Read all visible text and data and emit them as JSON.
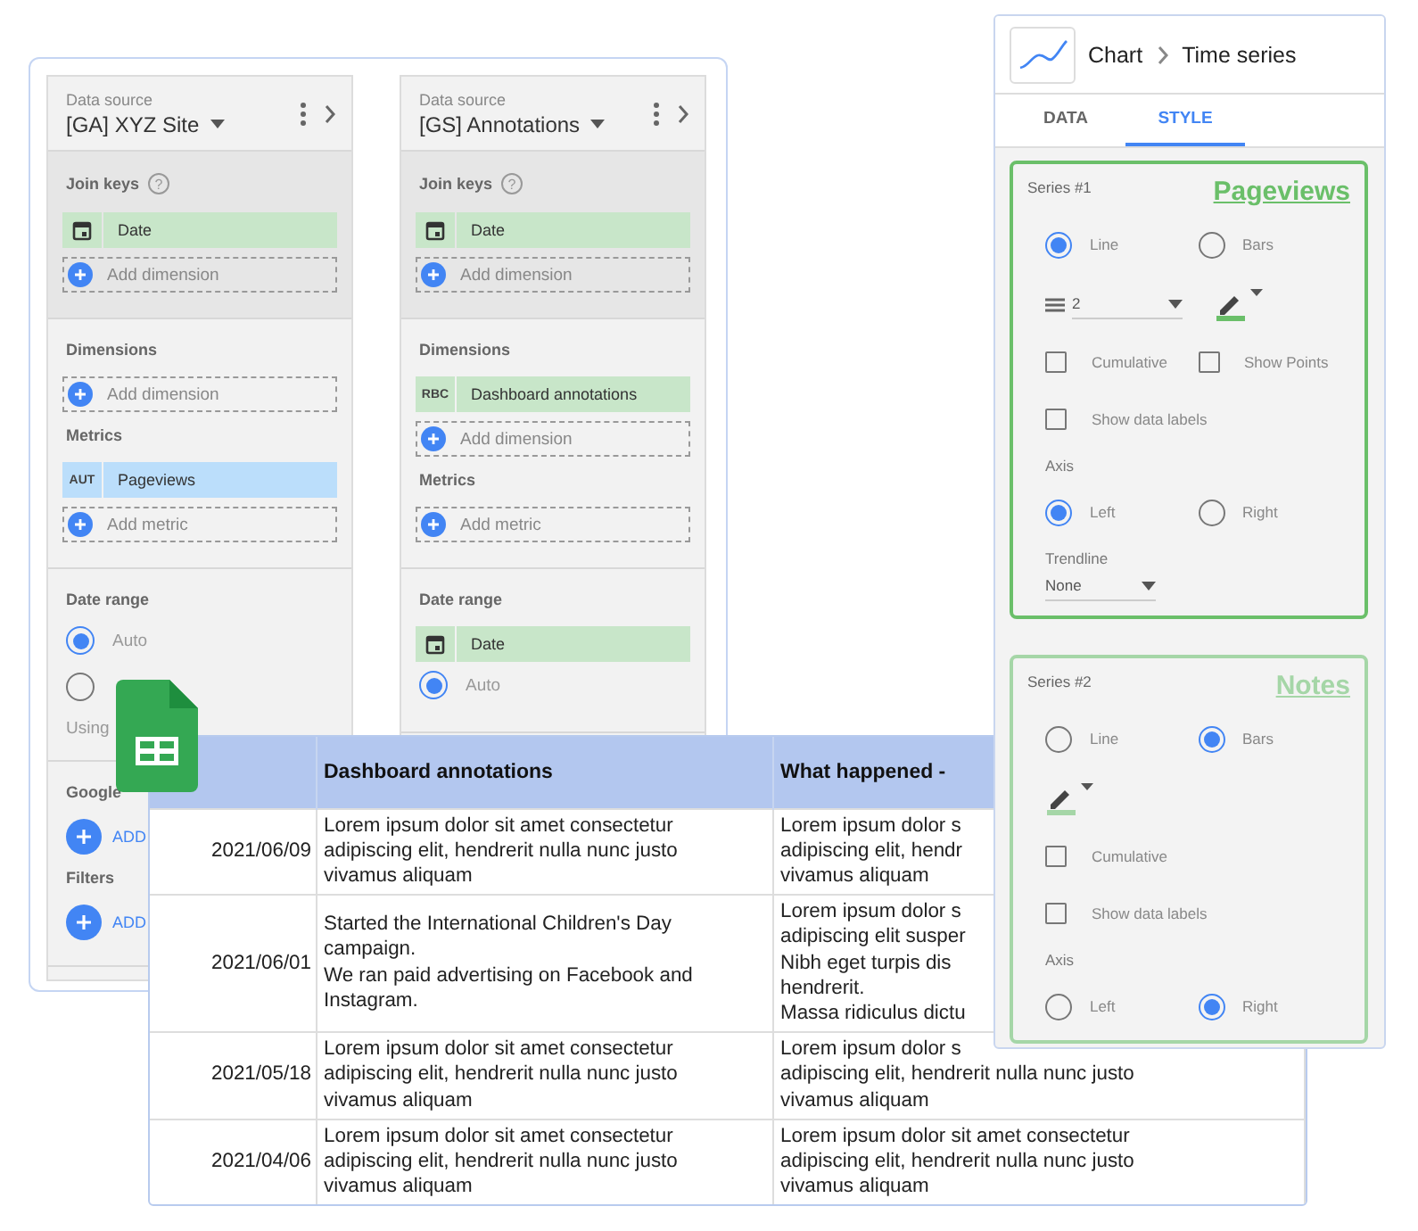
{
  "data_sources": [
    {
      "caption": "Data source",
      "name": "[GA] XYZ Site",
      "groups": [
        {
          "shaded": true,
          "blocks": [
            {
              "title": "Join keys",
              "help": "?",
              "items": [
                {
                  "kind": "date-chip",
                  "label": "Date",
                  "color": "#c8e6c9"
                },
                {
                  "kind": "add",
                  "label": "Add dimension"
                }
              ]
            }
          ]
        },
        {
          "shaded": false,
          "blocks": [
            {
              "title": "Dimensions",
              "items": [
                {
                  "kind": "add",
                  "label": "Add dimension"
                }
              ]
            },
            {
              "title": "Metrics",
              "items": [
                {
                  "kind": "chip",
                  "badge": "AUT",
                  "label": "Pageviews",
                  "color": "#bbdefb"
                },
                {
                  "kind": "add",
                  "label": "Add metric"
                }
              ]
            }
          ]
        },
        {
          "shaded": false,
          "blocks": [
            {
              "title": "Date range",
              "items": [
                {
                  "kind": "radio",
                  "label": "Auto",
                  "selected": true
                },
                {
                  "kind": "radio",
                  "selected": false
                },
                {
                  "kind": "note",
                  "label": "Using"
                }
              ]
            }
          ]
        },
        {
          "shaded": false,
          "blocks": [
            {
              "title": "Google",
              "items": [
                {
                  "kind": "link",
                  "label": "ADD"
                }
              ]
            },
            {
              "title": "Filters",
              "items": [
                {
                  "kind": "link",
                  "label": "ADD"
                }
              ]
            }
          ]
        }
      ]
    },
    {
      "caption": "Data source",
      "name": "[GS] Annotations",
      "groups": [
        {
          "shaded": true,
          "blocks": [
            {
              "title": "Join keys",
              "help": "?",
              "items": [
                {
                  "kind": "date-chip",
                  "label": "Date",
                  "color": "#c8e6c9"
                },
                {
                  "kind": "add",
                  "label": "Add dimension"
                }
              ]
            }
          ]
        },
        {
          "shaded": false,
          "blocks": [
            {
              "title": "Dimensions",
              "items": [
                {
                  "kind": "chip",
                  "badge": "RBC",
                  "label": "Dashboard annotations",
                  "color": "#c8e6c9"
                },
                {
                  "kind": "add",
                  "label": "Add dimension"
                }
              ]
            },
            {
              "title": "Metrics",
              "items": [
                {
                  "kind": "add",
                  "label": "Add metric"
                }
              ]
            }
          ]
        },
        {
          "shaded": false,
          "blocks": [
            {
              "title": "Date range",
              "items": [
                {
                  "kind": "date-chip",
                  "label": "Date",
                  "color": "#c8e6c9"
                },
                {
                  "kind": "radio",
                  "label": "Auto",
                  "selected": true
                }
              ]
            }
          ]
        }
      ]
    }
  ],
  "table": {
    "columns": [
      "Dashboard annotations",
      "What happened -"
    ],
    "rows": [
      {
        "date": "2021/06/09",
        "annotation": "Lorem ipsum dolor sit amet consectetur\nadipiscing elit, hendrerit nulla nunc justo\nvivamus aliquam",
        "detail": "Lorem ipsum dolor s\nadipiscing elit, hendr\nvivamus aliquam"
      },
      {
        "date": "2021/06/01",
        "annotation": "Started the International Children's Day\ncampaign.\nWe ran paid advertising on Facebook and\nInstagram.",
        "detail": "Lorem ipsum dolor s\nadipiscing elit susper\nNibh eget turpis dis\nhendrerit.\nMassa ridiculus dictu"
      },
      {
        "date": "2021/05/18",
        "annotation": "Lorem ipsum dolor sit amet consectetur\nadipiscing elit, hendrerit nulla nunc justo\nvivamus aliquam",
        "detail": "Lorem ipsum dolor s\nadipiscing elit, hendrerit nulla nunc justo\nvivamus aliquam"
      },
      {
        "date": "2021/04/06",
        "annotation": "Lorem ipsum dolor sit amet consectetur\nadipiscing elit, hendrerit nulla nunc justo\nvivamus aliquam",
        "detail": "Lorem ipsum dolor sit amet consectetur\nadipiscing elit, hendrerit nulla nunc justo\nvivamus aliquam"
      }
    ]
  },
  "chart": {
    "breadcrumb": [
      "Chart",
      "Time series"
    ],
    "tabs": [
      {
        "label": "DATA",
        "selected": false
      },
      {
        "label": "STYLE",
        "selected": true
      }
    ],
    "series": [
      {
        "caption": "Series #1",
        "title": "Pageviews",
        "color": "#6abf69",
        "controls": [
          {
            "kind": "radios",
            "options": [
              {
                "label": "Line",
                "selected": true
              },
              {
                "label": "Bars",
                "selected": false
              }
            ]
          },
          {
            "kind": "style",
            "weight": "2"
          },
          {
            "kind": "checks",
            "options": [
              {
                "label": "Cumulative",
                "checked": false
              },
              {
                "label": "Show Points",
                "checked": false
              }
            ]
          },
          {
            "kind": "checks",
            "options": [
              {
                "label": "Show data labels",
                "checked": false
              }
            ]
          },
          {
            "kind": "label",
            "label": "Axis"
          },
          {
            "kind": "radios",
            "options": [
              {
                "label": "Left",
                "selected": true
              },
              {
                "label": "Right",
                "selected": false
              }
            ]
          },
          {
            "kind": "select",
            "label": "Trendline",
            "value": "None"
          }
        ]
      },
      {
        "caption": "Series #2",
        "title": "Notes",
        "color": "#a5d6a7",
        "controls": [
          {
            "kind": "radios",
            "options": [
              {
                "label": "Line",
                "selected": false
              },
              {
                "label": "Bars",
                "selected": true
              }
            ]
          },
          {
            "kind": "style"
          },
          {
            "kind": "checks",
            "options": [
              {
                "label": "Cumulative",
                "checked": false
              }
            ]
          },
          {
            "kind": "checks",
            "options": [
              {
                "label": "Show data labels",
                "checked": false
              }
            ]
          },
          {
            "kind": "label",
            "label": "Axis"
          },
          {
            "kind": "radios",
            "options": [
              {
                "label": "Left",
                "selected": false
              },
              {
                "label": "Right",
                "selected": true
              }
            ]
          }
        ]
      }
    ]
  }
}
